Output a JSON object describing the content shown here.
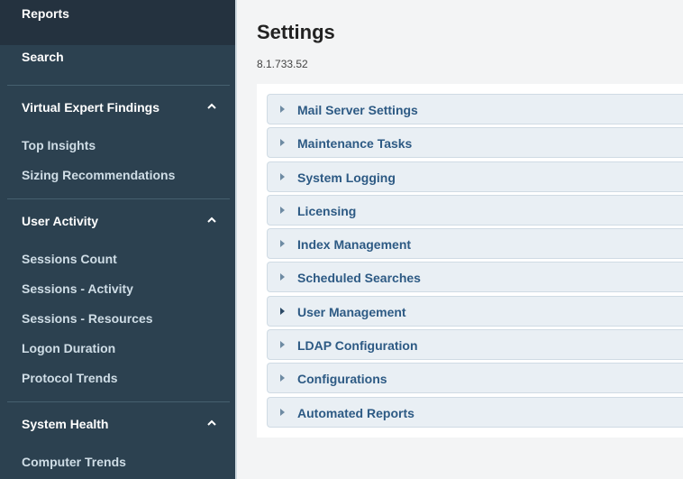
{
  "sidebar": {
    "reports": "Reports",
    "search": "Search",
    "sections": [
      {
        "title": "Virtual Expert Findings",
        "items": [
          "Top Insights",
          "Sizing Recommendations"
        ]
      },
      {
        "title": "User Activity",
        "items": [
          "Sessions Count",
          "Sessions - Activity",
          "Sessions - Resources",
          "Logon Duration",
          "Protocol Trends"
        ]
      },
      {
        "title": "System Health",
        "items": [
          "Computer Trends"
        ]
      }
    ]
  },
  "main": {
    "title": "Settings",
    "version": "8.1.733.52",
    "accordion": [
      "Mail Server Settings",
      "Maintenance Tasks",
      "System Logging",
      "Licensing",
      "Index Management",
      "Scheduled Searches",
      "User Management",
      "LDAP Configuration",
      "Configurations",
      "Automated Reports"
    ]
  },
  "colors": {
    "sidebar_bg": "#2c4150",
    "sidebar_top_bg": "#24323f",
    "accordion_bg": "#e9eff4",
    "accordion_text": "#2d5a84",
    "page_bg": "#f3f4f5"
  }
}
